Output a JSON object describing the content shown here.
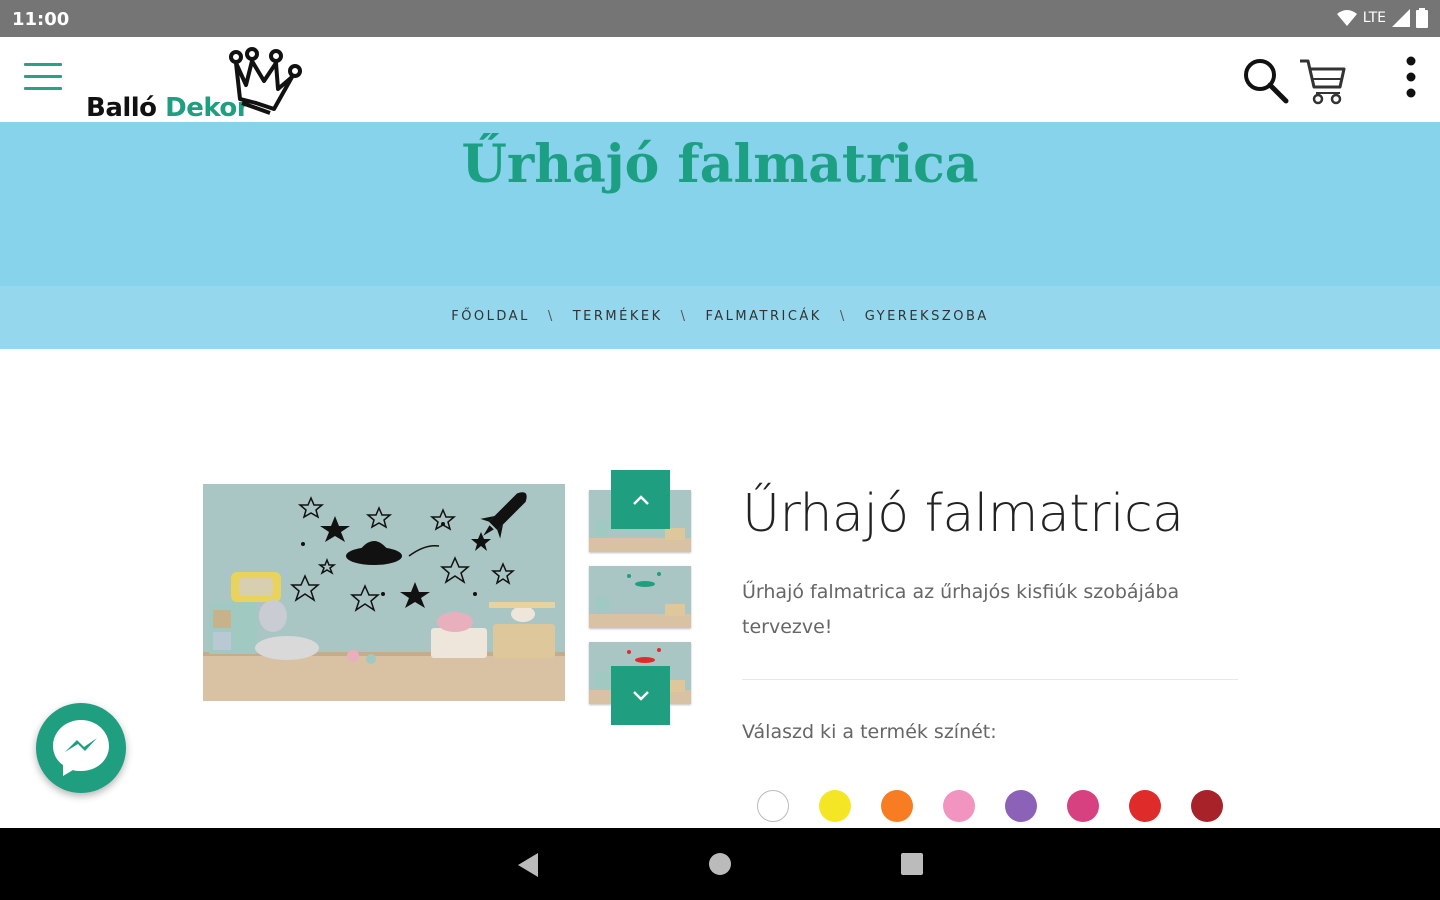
{
  "status_bar": {
    "time": "11:00",
    "network": "LTE"
  },
  "header": {
    "logo": {
      "part1": "Balló ",
      "part2": "Dekor"
    },
    "accent_color": "#1f9e80"
  },
  "hero": {
    "title": "Űrhajó falmatrica",
    "background": "#87d3ec"
  },
  "breadcrumb": {
    "items": [
      "FŐOLDAL",
      "TERMÉKEK",
      "FALMATRICÁK",
      "GYEREKSZOBA"
    ],
    "separator": "\\"
  },
  "product": {
    "title": "Űrhajó falmatrica",
    "description": "Űrhajó falmatrica az űrhajós kisfiúk szobájába tervezve!",
    "color_label": "Válaszd ki a termék színét:",
    "colors": [
      "#ffffff",
      "#f5e625",
      "#f77c22",
      "#f294c0",
      "#8c62b8",
      "#d7417f",
      "#e02b2b",
      "#a8222a"
    ]
  },
  "icons": {
    "menu": "hamburger-icon",
    "search": "search-icon",
    "cart": "cart-icon",
    "more": "more-vert-icon",
    "messenger": "messenger-icon",
    "thumb_up": "chevron-up-icon",
    "thumb_down": "chevron-down-icon"
  }
}
